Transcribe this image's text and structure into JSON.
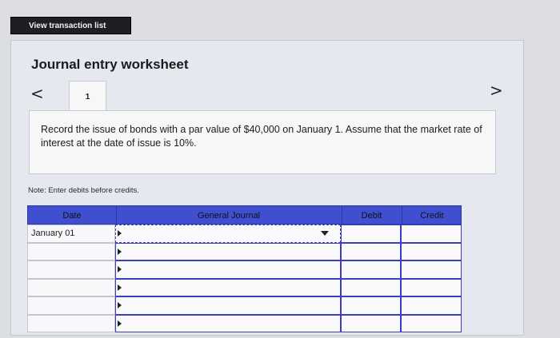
{
  "header": {
    "view_list_label": "View transaction list"
  },
  "worksheet": {
    "title": "Journal entry worksheet",
    "prev_symbol": "<",
    "next_symbol": ">",
    "tabs": [
      {
        "label": "1"
      }
    ],
    "instruction": "Record the issue of bonds with a par value of $40,000 on January 1. Assume that the market rate of interest at the date of issue is 10%.",
    "note": "Note: Enter debits before credits."
  },
  "table": {
    "headers": {
      "date": "Date",
      "account": "General Journal",
      "debit": "Debit",
      "credit": "Credit"
    },
    "rows": [
      {
        "date": "January 01",
        "account": "",
        "debit": "",
        "credit": ""
      },
      {
        "date": "",
        "account": "",
        "debit": "",
        "credit": ""
      },
      {
        "date": "",
        "account": "",
        "debit": "",
        "credit": ""
      },
      {
        "date": "",
        "account": "",
        "debit": "",
        "credit": ""
      },
      {
        "date": "",
        "account": "",
        "debit": "",
        "credit": ""
      },
      {
        "date": "",
        "account": "",
        "debit": "",
        "credit": ""
      }
    ]
  },
  "colors": {
    "header_blue": "#3f4fcf",
    "button_dark": "#1f1f22"
  },
  "icons": {
    "prev": "chevron-left-icon",
    "next": "chevron-right-icon",
    "dropdown": "caret-down-icon"
  }
}
